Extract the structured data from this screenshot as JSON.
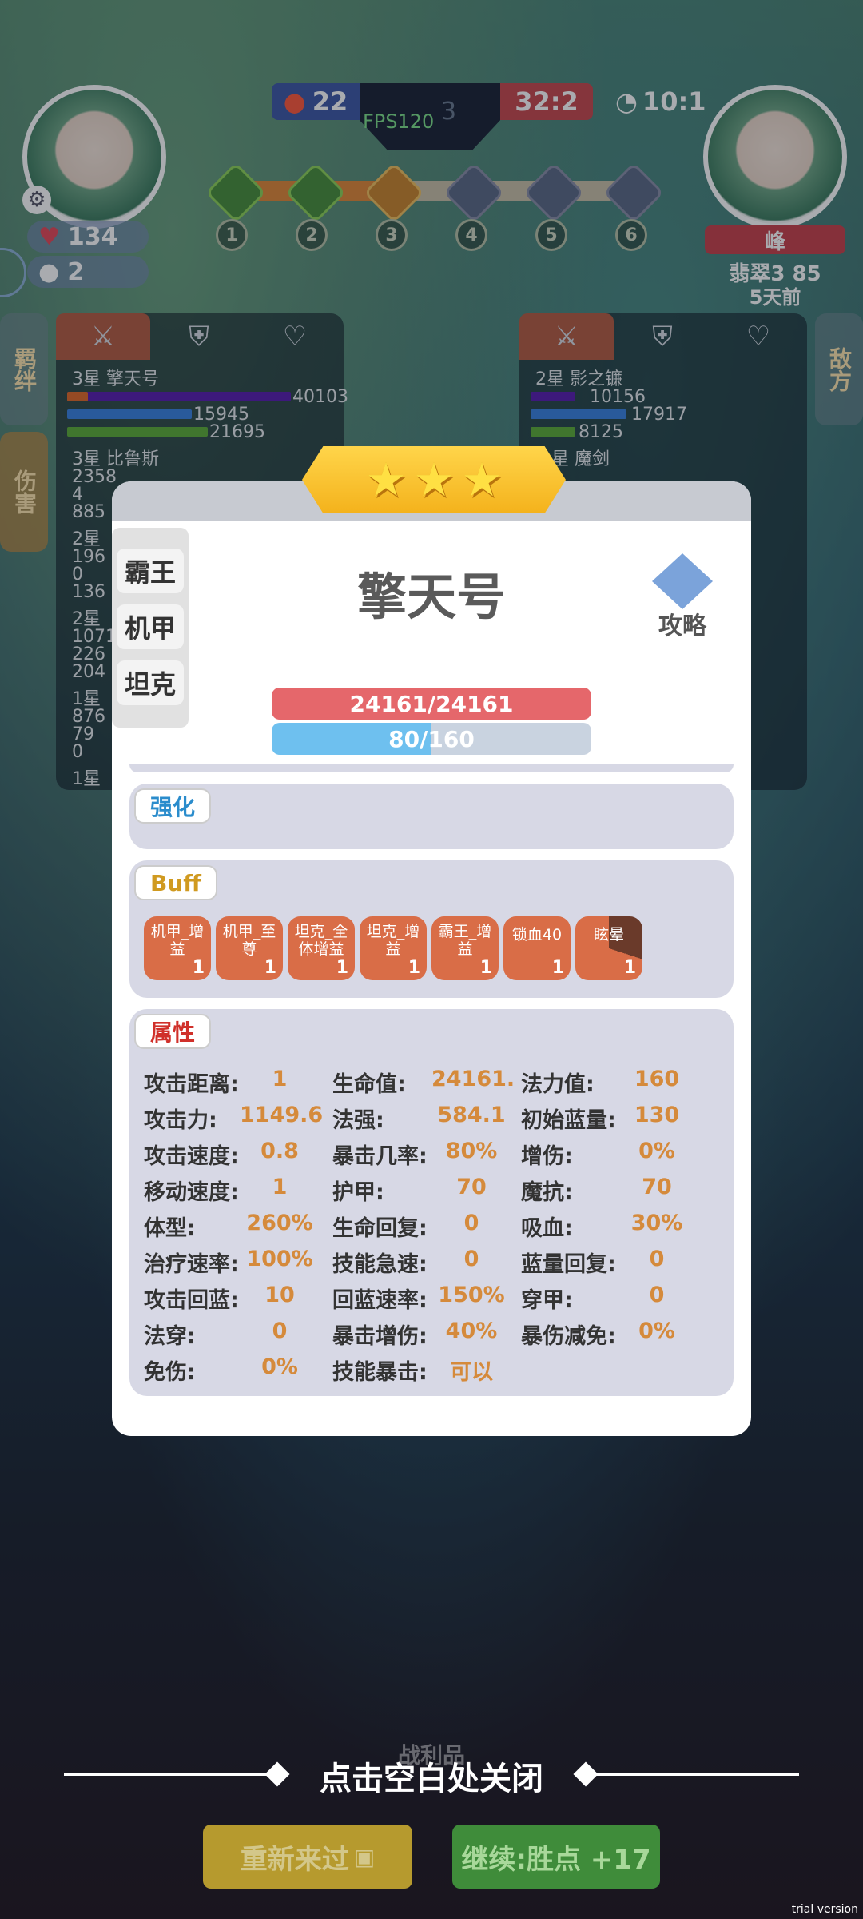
{
  "hud": {
    "left_player": {
      "hp": "134",
      "gold": "2"
    },
    "right_player": {
      "name": "峰",
      "rank": "翡翠3 85",
      "time_ago": "5天前"
    },
    "score_left": "22",
    "score_right": "32:2",
    "timer": "10:1",
    "fps": "FPS120",
    "round_ghost": "3",
    "stages": [
      "1",
      "2",
      "3",
      "4",
      "5",
      "6"
    ]
  },
  "side_buttons": {
    "left_top": "羁绊",
    "left_bottom": "伤害",
    "right": "敌方"
  },
  "left_list": [
    {
      "name": "3星 擎天号",
      "v1": "40103",
      "v2": "15945",
      "v3": "21695"
    },
    {
      "name": "3星 比鲁斯",
      "v1": "2358",
      "v2": "4",
      "v3": "885"
    },
    {
      "name": "2星",
      "v1": "196",
      "v2": "0",
      "v3": "136"
    },
    {
      "name": "2星",
      "v1": "1071",
      "v2": "226",
      "v3": "204"
    },
    {
      "name": "1星",
      "v1": "876",
      "v2": "79",
      "v3": "0"
    },
    {
      "name": "1星",
      "v1": "",
      "v2": "",
      "v3": ""
    }
  ],
  "right_list": [
    {
      "name": "2星 影之镰",
      "v1": "10156",
      "v2": "17917",
      "v3": "8125"
    },
    {
      "name": "星 魔剑",
      "v1": "",
      "v2": "",
      "v3": ""
    }
  ],
  "modal": {
    "stars": [
      "★",
      "★",
      "★"
    ],
    "tags": [
      "霸王",
      "机甲",
      "坦克"
    ],
    "title": "擎天号",
    "guide_label": "攻略",
    "hp_text": "24161/24161",
    "mp_text": "80/160",
    "section_enhance": "强化",
    "section_buff": "Buff",
    "section_attr": "属性",
    "buffs": [
      {
        "name": "机甲_增益",
        "count": "1"
      },
      {
        "name": "机甲_至尊",
        "count": "1"
      },
      {
        "name": "坦克_全体增益",
        "count": "1"
      },
      {
        "name": "坦克_增益",
        "count": "1"
      },
      {
        "name": "霸王_增益",
        "count": "1"
      },
      {
        "name": "锁血40",
        "count": "1"
      },
      {
        "name": "眩晕",
        "count": "1"
      }
    ],
    "attributes": [
      [
        {
          "k": "攻击距离:",
          "v": "1"
        },
        {
          "k": "生命值:",
          "v": "24161."
        },
        {
          "k": "法力值:",
          "v": "160"
        }
      ],
      [
        {
          "k": "攻击力:",
          "v": "1149.6"
        },
        {
          "k": "法强:",
          "v": "584.1"
        },
        {
          "k": "初始蓝量:",
          "v": "130"
        }
      ],
      [
        {
          "k": "攻击速度:",
          "v": "0.8"
        },
        {
          "k": "暴击几率:",
          "v": "80%"
        },
        {
          "k": "增伤:",
          "v": "0%"
        }
      ],
      [
        {
          "k": "移动速度:",
          "v": "1"
        },
        {
          "k": "护甲:",
          "v": "70"
        },
        {
          "k": "魔抗:",
          "v": "70"
        }
      ],
      [
        {
          "k": "体型:",
          "v": "260%"
        },
        {
          "k": "生命回复:",
          "v": "0"
        },
        {
          "k": "吸血:",
          "v": "30%"
        }
      ],
      [
        {
          "k": "治疗速率:",
          "v": "100%"
        },
        {
          "k": "技能急速:",
          "v": "0"
        },
        {
          "k": "蓝量回复:",
          "v": "0"
        }
      ],
      [
        {
          "k": "攻击回蓝:",
          "v": "10"
        },
        {
          "k": "回蓝速率:",
          "v": "150%"
        },
        {
          "k": "穿甲:",
          "v": "0"
        }
      ],
      [
        {
          "k": "法穿:",
          "v": "0"
        },
        {
          "k": "暴击增伤:",
          "v": "40%"
        },
        {
          "k": "暴伤减免:",
          "v": "0%"
        }
      ],
      [
        {
          "k": "免伤:",
          "v": "0%"
        },
        {
          "k": "技能暴击:",
          "v": "可以"
        }
      ]
    ]
  },
  "footer": {
    "close_hint": "点击空白处关闭",
    "ghost_label": "战利品",
    "retry_label": "重新来过",
    "continue_label": "继续:胜点 +17",
    "watermark": "trial version"
  }
}
